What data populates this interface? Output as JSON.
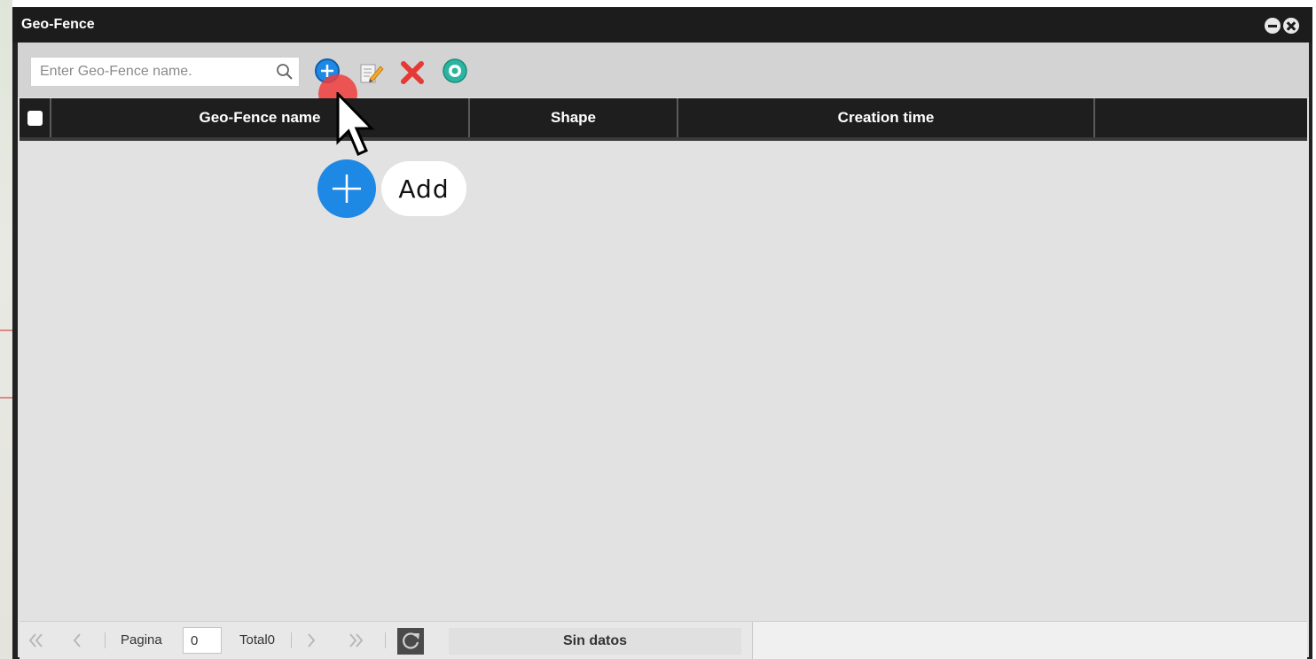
{
  "window": {
    "title": "Geo-Fence",
    "minimize_icon": "minus-circle-icon",
    "close_icon": "close-circle-icon"
  },
  "toolbar": {
    "search": {
      "placeholder": "Enter Geo-Fence name.",
      "value": "",
      "icon": "search-icon"
    },
    "buttons": [
      {
        "icon": "add-icon",
        "color": "#1e88e5"
      },
      {
        "icon": "edit-icon"
      },
      {
        "icon": "delete-icon",
        "color": "#e53935"
      },
      {
        "icon": "view-icon",
        "color": "#2bb5a0"
      }
    ]
  },
  "grid": {
    "columns": [
      "Geo-Fence name",
      "Shape",
      "Creation time",
      ""
    ],
    "rows": []
  },
  "pager": {
    "page_label": "Pagina",
    "page_value": "0",
    "total_label": "Total0",
    "status": "Sin datos"
  },
  "tooltip": {
    "label": "Add",
    "icon": "plus-icon",
    "color": "#1e88e5"
  }
}
